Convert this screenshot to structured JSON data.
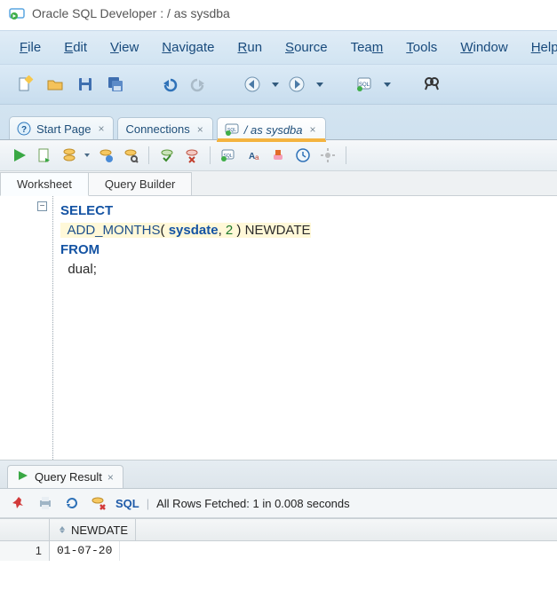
{
  "title": "Oracle SQL Developer : / as sysdba",
  "menu": [
    "File",
    "Edit",
    "View",
    "Navigate",
    "Run",
    "Source",
    "Team",
    "Tools",
    "Window",
    "Help"
  ],
  "tabs": {
    "start": "Start Page",
    "connections": "Connections",
    "active": "/ as sysdba"
  },
  "subtabs": {
    "worksheet": "Worksheet",
    "querybuilder": "Query Builder"
  },
  "sql": {
    "l1": "SELECT",
    "l2_indent": "  ",
    "l2_fn": "ADD_MONTHS",
    "l2_open": "( ",
    "l2_arg1": "sysdate",
    "l2_comma": ", ",
    "l2_arg2": "2",
    "l2_close": " ) ",
    "l2_alias": "NEWDATE",
    "l3": "FROM",
    "l4_indent": "  ",
    "l4_tbl": "dual",
    "l4_semi": ";"
  },
  "fold_symbol": "−",
  "results": {
    "tab": "Query Result",
    "sql_label": "SQL",
    "status": "All Rows Fetched: 1 in 0.008 seconds",
    "column": "NEWDATE",
    "rows": [
      {
        "n": "1",
        "newdate": "01-07-20"
      }
    ]
  }
}
